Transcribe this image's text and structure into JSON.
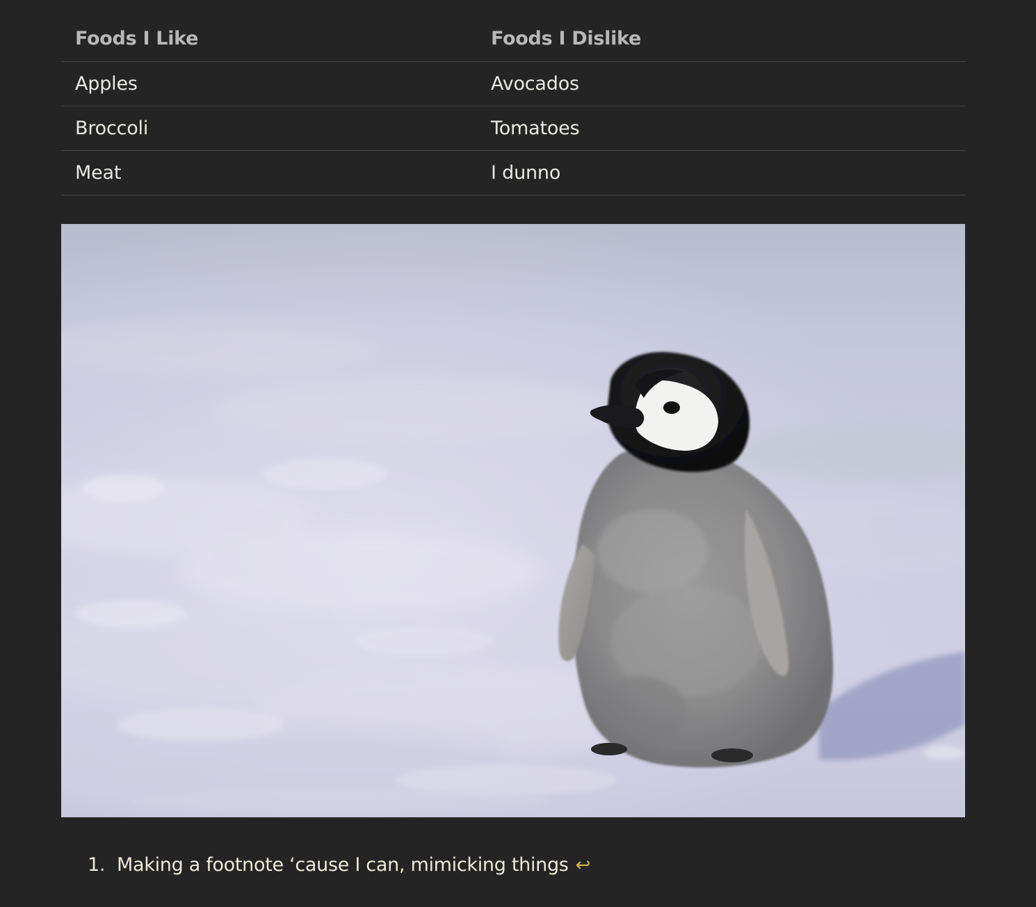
{
  "table": {
    "headers": [
      "Foods I Like",
      "Foods I Dislike"
    ],
    "rows": [
      [
        "Apples",
        "Avocados"
      ],
      [
        "Broccoli",
        "Tomatoes"
      ],
      [
        "Meat",
        "I dunno"
      ]
    ]
  },
  "image": {
    "subject": "penguin-chick-on-snow"
  },
  "footnotes": [
    {
      "number": "1.",
      "text": "Making a footnote ‘cause I can, mimicking things",
      "backref_icon": "return-arrow-icon",
      "backref_glyph": "↩"
    }
  ],
  "colors": {
    "background": "#242424",
    "header_text": "#b8b8b8",
    "body_text": "#e9e9e4",
    "rule": "#474747",
    "backref": "#d8b24a"
  }
}
